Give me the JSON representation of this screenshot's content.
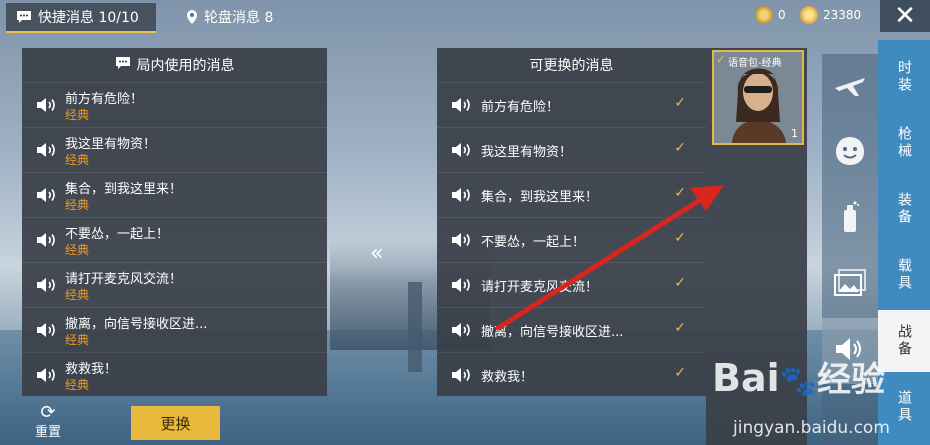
{
  "tabs": {
    "quick_messages": "快捷消息 10/10",
    "wheel_messages": "轮盘消息 8"
  },
  "currency": {
    "coupon_value": "0",
    "coin_value": "23380"
  },
  "left_panel": {
    "title": "局内使用的消息",
    "items": [
      {
        "text": "前方有危险！",
        "tag": "经典"
      },
      {
        "text": "我这里有物资！",
        "tag": "经典"
      },
      {
        "text": "集合，到我这里来！",
        "tag": "经典"
      },
      {
        "text": "不要怂，一起上！",
        "tag": "经典"
      },
      {
        "text": "请打开麦克风交流！",
        "tag": "经典"
      },
      {
        "text": "撤离，向信号接收区进...",
        "tag": "经典"
      },
      {
        "text": "救救我！",
        "tag": "经典"
      }
    ]
  },
  "right_panel": {
    "title": "可更换的消息",
    "items": [
      {
        "text": "前方有危险！"
      },
      {
        "text": "我这里有物资！"
      },
      {
        "text": "集合，到我这里来！"
      },
      {
        "text": "不要怂，一起上！"
      },
      {
        "text": "请打开麦克风交流！"
      },
      {
        "text": "撤离，向信号接收区进..."
      },
      {
        "text": "救救我！"
      }
    ]
  },
  "voice_pack_card": {
    "label": "语音包-经典",
    "count": "1"
  },
  "categories": [
    "时装",
    "枪械",
    "装备",
    "载具",
    "战备",
    "道具"
  ],
  "buttons": {
    "reset": "重置",
    "swap": "更换"
  },
  "watermark": {
    "brand_prefix": "Bai",
    "brand_suffix": "经验",
    "url": "jingyan.baidu.com"
  },
  "colors": {
    "accent": "#e8b93a",
    "tag_orange": "#e99a25",
    "category_blue": "#3f8bc0"
  }
}
